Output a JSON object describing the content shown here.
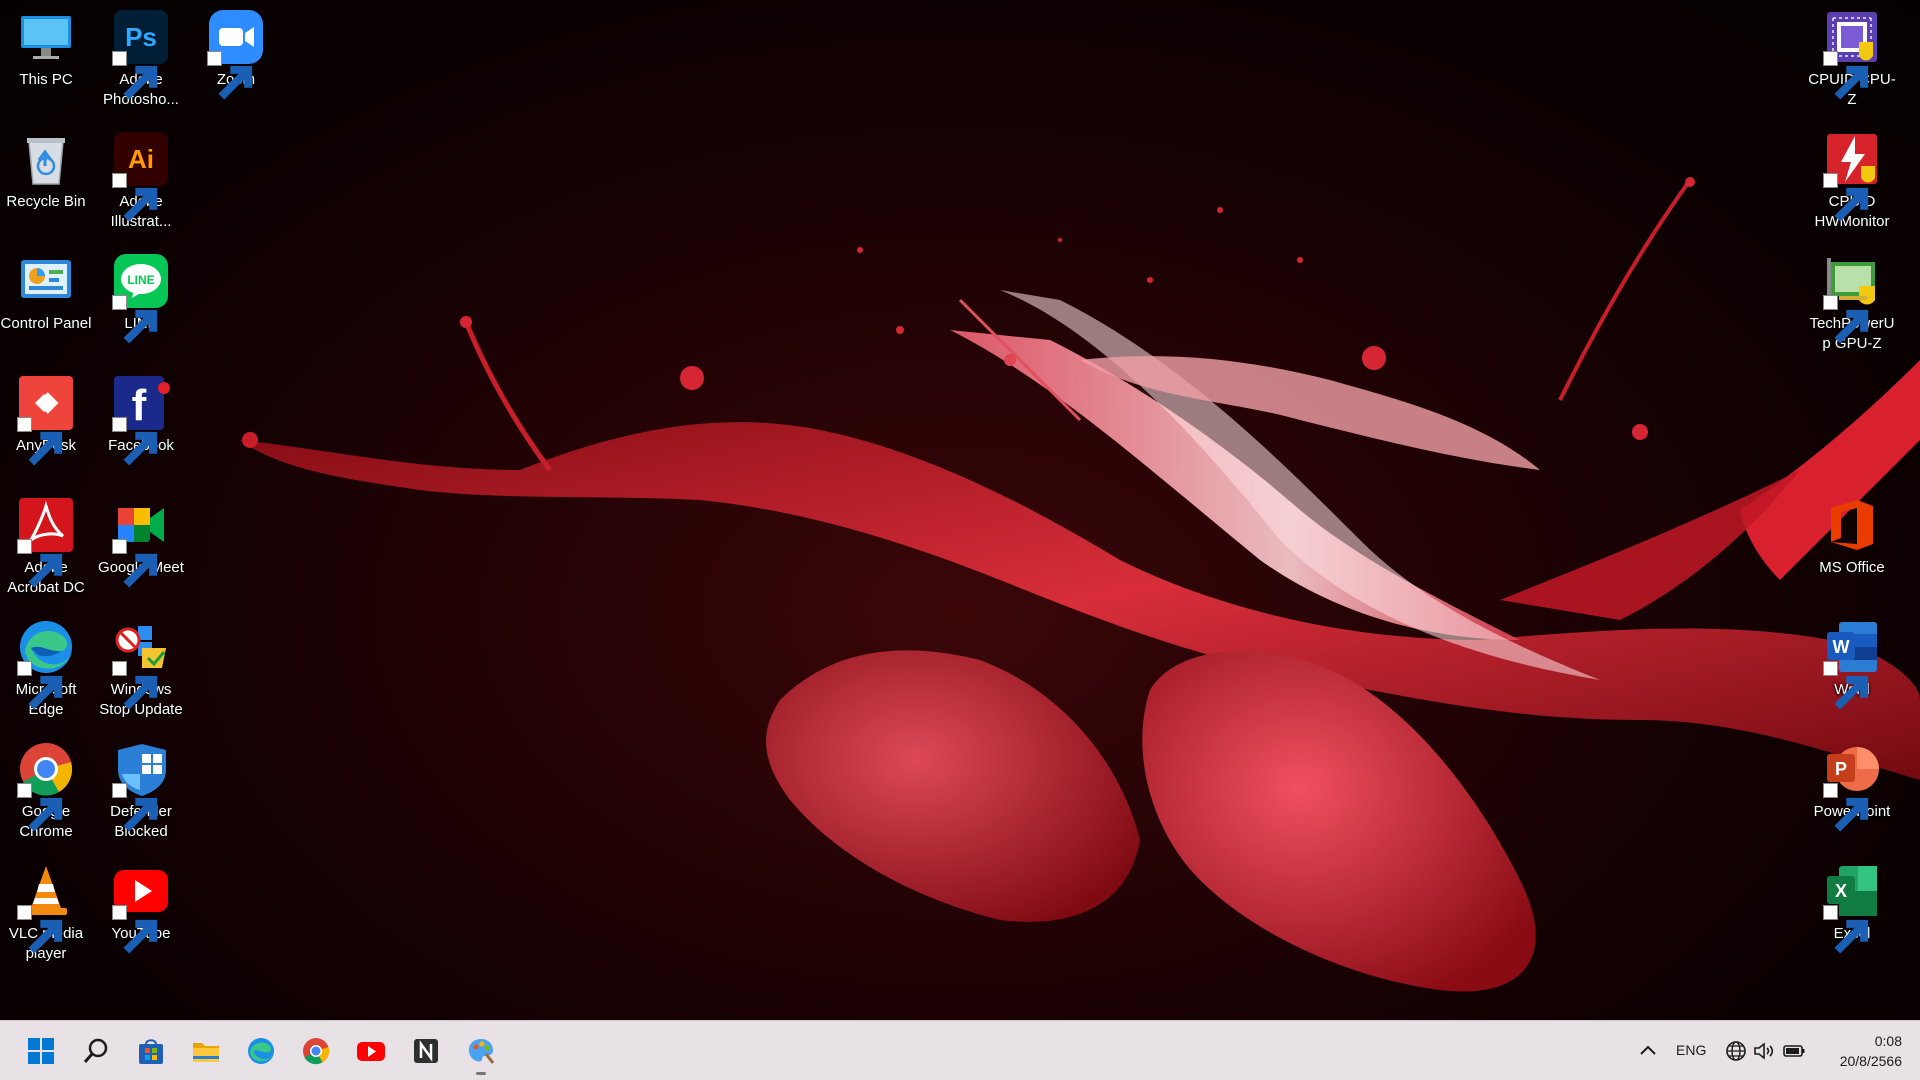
{
  "desktop": {
    "left_col1": [
      {
        "label": "This PC",
        "icon": "monitor-icon"
      },
      {
        "label": "Recycle Bin",
        "icon": "recycle-bin-icon"
      },
      {
        "label": "Control Panel",
        "icon": "control-panel-icon"
      },
      {
        "label": "AnyDesk",
        "icon": "anydesk-icon"
      },
      {
        "label": "Adobe Acrobat DC",
        "icon": "acrobat-icon"
      },
      {
        "label": "Microsoft Edge",
        "icon": "edge-icon"
      },
      {
        "label": "Google Chrome",
        "icon": "chrome-icon"
      },
      {
        "label": "VLC media player",
        "icon": "vlc-icon"
      }
    ],
    "left_col2": [
      {
        "label": "Adobe Photosho...",
        "icon": "photoshop-icon"
      },
      {
        "label": "Adobe Illustrat...",
        "icon": "illustrator-icon"
      },
      {
        "label": "LINE",
        "icon": "line-icon"
      },
      {
        "label": "Facebook",
        "icon": "facebook-icon"
      },
      {
        "label": "Google Meet",
        "icon": "google-meet-icon"
      },
      {
        "label": "Windows Stop Update",
        "icon": "windows-stop-update-icon"
      },
      {
        "label": "Defender Blocked",
        "icon": "defender-icon"
      },
      {
        "label": "YouTube",
        "icon": "youtube-icon"
      }
    ],
    "left_col3": [
      {
        "label": "Zoom",
        "icon": "zoom-icon"
      }
    ],
    "right_col": [
      {
        "label": "CPUID CPU-Z",
        "icon": "cpuz-icon"
      },
      {
        "label": "CPUID HWMonitor",
        "icon": "hwmonitor-icon"
      },
      {
        "label": "TechPowerUp GPU-Z",
        "icon": "gpuz-icon"
      },
      {
        "label": "MS Office",
        "icon": "office-icon"
      },
      {
        "label": "Word",
        "icon": "word-icon"
      },
      {
        "label": "PowerPoint",
        "icon": "powerpoint-icon"
      },
      {
        "label": "Excel",
        "icon": "excel-icon"
      }
    ]
  },
  "taskbar": {
    "apps": [
      {
        "name": "start",
        "icon": "windows-start-icon"
      },
      {
        "name": "search",
        "icon": "search-icon"
      },
      {
        "name": "store",
        "icon": "store-icon"
      },
      {
        "name": "file-explorer",
        "icon": "folder-icon"
      },
      {
        "name": "edge",
        "icon": "edge-icon"
      },
      {
        "name": "chrome",
        "icon": "chrome-icon"
      },
      {
        "name": "youtube",
        "icon": "youtube-icon"
      },
      {
        "name": "notion",
        "icon": "notion-icon"
      },
      {
        "name": "paint",
        "icon": "paint-icon"
      }
    ],
    "tray": {
      "language": "ENG",
      "time": "0:08",
      "date": "20/8/2566"
    }
  },
  "colors": {
    "wallpaper_base": "#1c0204",
    "paint_red": "#d01e2c",
    "taskbar_bg": "#e8e2e6",
    "windows_blue": "#0078d4"
  }
}
